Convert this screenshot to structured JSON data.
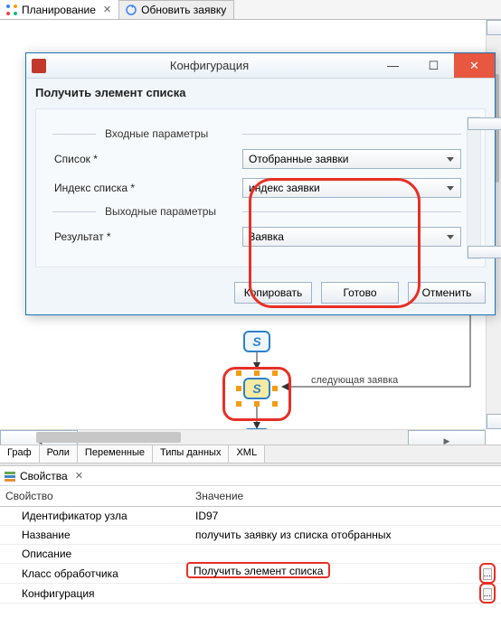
{
  "tabs": {
    "main": "Планирование",
    "secondary": "Обновить заявку"
  },
  "dialog": {
    "title": "Конфигурация",
    "subtitle": "Получить элемент списка",
    "section_in": "Входные параметры",
    "section_out": "Выходные параметры",
    "labels": {
      "list": "Список *",
      "index": "Индекс списка *",
      "result": "Результат *"
    },
    "values": {
      "list": "Отобранные заявки",
      "index": "индекс заявки",
      "result": "Заявка"
    },
    "buttons": {
      "copy": "Копировать",
      "ok": "Готово",
      "cancel": "Отменить"
    }
  },
  "diagram": {
    "arrow_label": "следующая заявка"
  },
  "canvas_tabs": [
    "Граф",
    "Роли",
    "Переменные",
    "Типы данных",
    "XML"
  ],
  "props": {
    "panel_title": "Свойства",
    "col_key": "Свойство",
    "col_val": "Значение",
    "rows": {
      "id": {
        "k": "Идентификатор узла",
        "v": "ID97"
      },
      "name": {
        "k": "Название",
        "v": "получить заявку из списка отобранных"
      },
      "desc": {
        "k": "Описание",
        "v": ""
      },
      "handler": {
        "k": "Класс обработчика",
        "v": "Получить элемент списка"
      },
      "config": {
        "k": "Конфигурация",
        "v": ""
      }
    },
    "ellipsis": "..."
  }
}
